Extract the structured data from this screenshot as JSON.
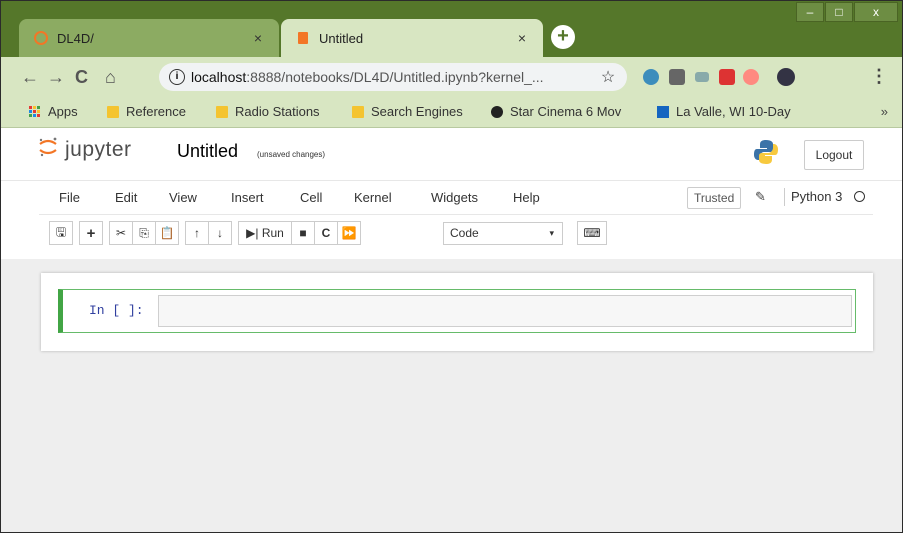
{
  "browser": {
    "tabs": [
      {
        "title": "DL4D/",
        "active": false,
        "close": "×"
      },
      {
        "title": "Untitled",
        "active": true,
        "close": "×"
      }
    ],
    "new_tab": "+",
    "window_controls": {
      "minimize": "–",
      "maximize": "□",
      "close": "x"
    },
    "nav": {
      "back": "←",
      "forward": "→",
      "reload": "C",
      "home": "⌂"
    },
    "url": {
      "info": "i",
      "host": "localhost",
      "rest": ":8888/notebooks/DL4D/Untitled.ipynb?kernel_...",
      "star": "☆"
    },
    "menu": "⋮",
    "bookmarks": [
      {
        "label": "Apps",
        "icon": "apps-grid-icon"
      },
      {
        "label": "Reference",
        "icon": "folder-icon"
      },
      {
        "label": "Radio Stations",
        "icon": "folder-icon"
      },
      {
        "label": "Search Engines",
        "icon": "folder-icon"
      },
      {
        "label": "Star Cinema 6 Mov",
        "icon": "film-icon"
      },
      {
        "label": "La Valle, WI 10-Day",
        "icon": "weather-icon"
      }
    ],
    "bookmarks_more": "»"
  },
  "jupyter": {
    "logo_text": "jupyter",
    "notebook_name": "Untitled",
    "save_status": "(unsaved changes)",
    "logout_label": "Logout",
    "menus": [
      "File",
      "Edit",
      "View",
      "Insert",
      "Cell",
      "Kernel",
      "Widgets",
      "Help"
    ],
    "trusted_label": "Trusted",
    "kernel_name": "Python 3",
    "toolbar": {
      "save": "🖫",
      "add": "+",
      "cut": "✂",
      "copy": "⎘",
      "paste": "📋",
      "up": "↑",
      "down": "↓",
      "run": "▶| Run",
      "interrupt": "■",
      "restart": "C",
      "restart_run": "⏩",
      "cell_type": "Code",
      "dropdown_arrow": "▾",
      "keyboard": "⌨"
    },
    "cell": {
      "prompt": "In [ ]:",
      "source": ""
    }
  },
  "colors": {
    "titlebar": "#55772a",
    "active_tab": "#d8e6c2",
    "inactive_tab": "#8cab62",
    "cell_border": "#42a545",
    "prompt": "#303f9f"
  }
}
